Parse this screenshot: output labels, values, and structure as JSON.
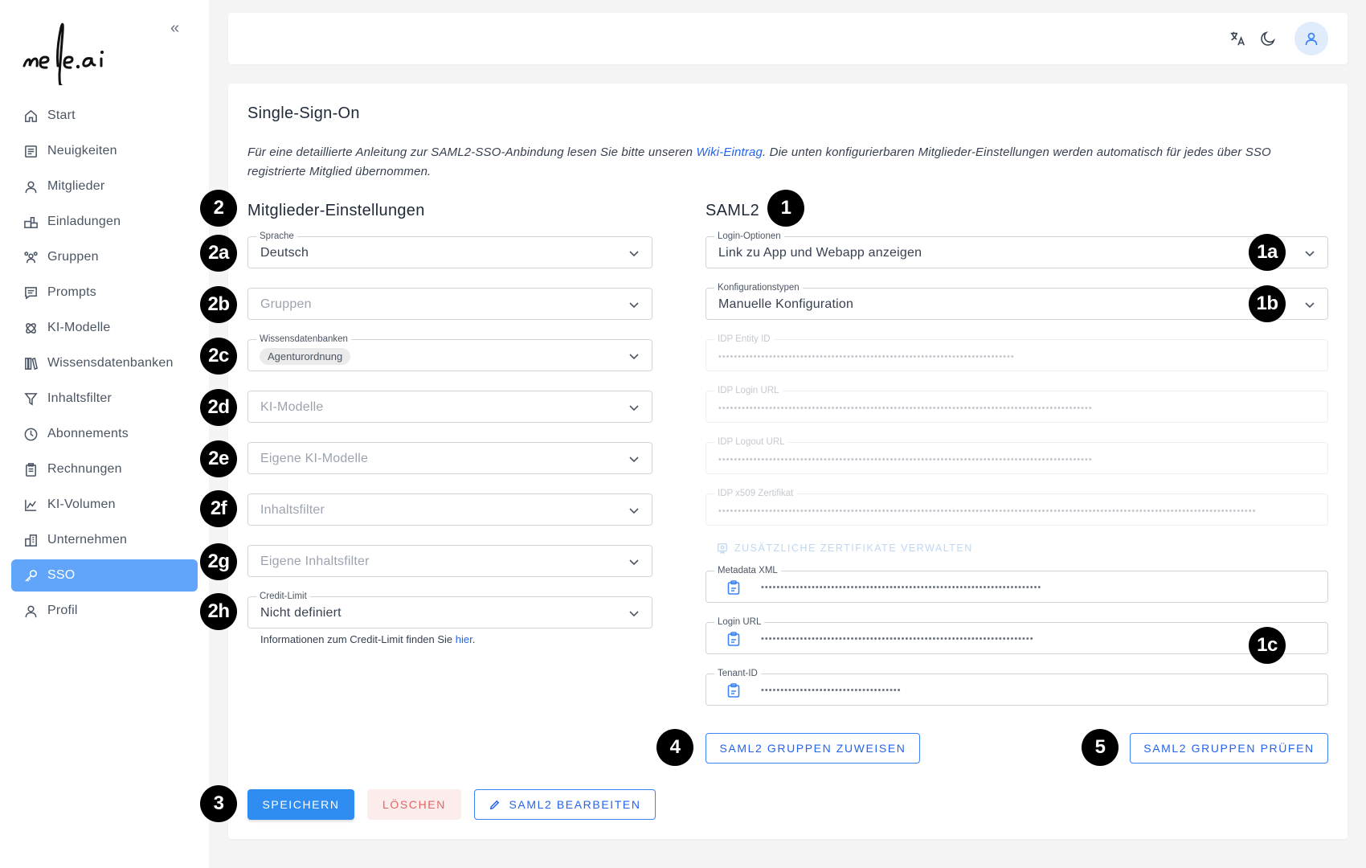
{
  "sidebar": {
    "brand": "nele.ai",
    "collapse_icon": "chevrons-left-icon",
    "items": [
      {
        "label": "Start",
        "icon": "home-icon"
      },
      {
        "label": "Neuigkeiten",
        "icon": "news-icon"
      },
      {
        "label": "Mitglieder",
        "icon": "user-icon"
      },
      {
        "label": "Einladungen",
        "icon": "invitation-icon"
      },
      {
        "label": "Gruppen",
        "icon": "group-icon"
      },
      {
        "label": "Prompts",
        "icon": "prompt-icon"
      },
      {
        "label": "KI-Modelle",
        "icon": "ai-model-icon"
      },
      {
        "label": "Wissensdatenbanken",
        "icon": "library-icon"
      },
      {
        "label": "Inhaltsfilter",
        "icon": "filter-icon"
      },
      {
        "label": "Abonnements",
        "icon": "clock-icon"
      },
      {
        "label": "Rechnungen",
        "icon": "clipboard-icon"
      },
      {
        "label": "KI-Volumen",
        "icon": "chart-icon"
      },
      {
        "label": "Unternehmen",
        "icon": "building-icon"
      },
      {
        "label": "SSO",
        "icon": "key-icon",
        "active": true
      },
      {
        "label": "Profil",
        "icon": "user-icon"
      }
    ],
    "active_color": "#60a5fa"
  },
  "topbar": {
    "icons": [
      "translate-icon",
      "dark-mode-moon-icon",
      "user-avatar-icon"
    ]
  },
  "page": {
    "title": "Single-Sign-On",
    "intro_part1": "Für eine detaillierte Anleitung zur SAML2-SSO-Anbindung lesen Sie bitte unseren ",
    "intro_link": "Wiki-Eintrag",
    "intro_part2": ". Die unten konfigurierbaren Mitglieder-Einstellungen werden automatisch für jedes über SSO registrierte Mitglied übernommen."
  },
  "members": {
    "title": "Mitglieder-Einstellungen",
    "sprache": {
      "label": "Sprache",
      "value": "Deutsch"
    },
    "gruppen": {
      "placeholder": "Gruppen"
    },
    "wissen": {
      "label": "Wissensdatenbanken",
      "chip": "Agenturordnung"
    },
    "ki": {
      "placeholder": "KI-Modelle"
    },
    "eigene_ki": {
      "placeholder": "Eigene KI-Modelle"
    },
    "filter": {
      "placeholder": "Inhaltsfilter"
    },
    "eigene_filter": {
      "placeholder": "Eigene Inhaltsfilter"
    },
    "credit": {
      "label": "Credit-Limit",
      "value": "Nicht definiert"
    },
    "help_text": "Informationen zum Credit-Limit finden Sie ",
    "help_link": "hier",
    "help_end": "."
  },
  "saml": {
    "title": "SAML2",
    "login_options": {
      "label": "Login-Optionen",
      "value": "Link zu App und Webapp anzeigen"
    },
    "config_type": {
      "label": "Konfigurationstypen",
      "value": "Manuelle Konfiguration"
    },
    "idp_entity": {
      "label": "IDP Entity ID",
      "masked": "••••••••••••••••••••••••••••••••••••••••••••••••••••••••••••••••••••••••••••"
    },
    "idp_login": {
      "label": "IDP Login URL",
      "masked": "••••••••••••••••••••••••••••••••••••••••••••••••••••••••••••••••••••••••••••••••••••••••••••••••"
    },
    "idp_logout": {
      "label": "IDP Logout URL",
      "masked": "••••••••••••••••••••••••••••••••••••••••••••••••••••••••••••••••••••••••••••••••••••••••••••••••"
    },
    "idp_cert": {
      "label": "IDP x509 Zertifikat",
      "masked": "••••••••••••••••••••••••••••••••••••••••••••••••••••••••••••••••••••••••••••••••••••••••••••••••••••••••••••••••••••••••••••••••••••••••••"
    },
    "extra_certs": "ZUSÄTZLICHE ZERTIFIKATE VERWALTEN",
    "metadata": {
      "label": "Metadata XML",
      "masked": "••••••••••••••••••••••••••••••••••••••••••••••••••••••••••••••••••••••••"
    },
    "login_url": {
      "label": "Login URL",
      "masked": "••••••••••••••••••••••••••••••••••••••••••••••••••••••••••••••••••••••"
    },
    "tenant": {
      "label": "Tenant-ID",
      "masked": "••••••••••••••••••••••••••••••••••••"
    }
  },
  "buttons": {
    "assign": "SAML2 GRUPPEN ZUWEISEN",
    "check": "SAML2 GRUPPEN PRÜFEN",
    "save": "SPEICHERN",
    "delete": "LÖSCHEN",
    "edit": "SAML2 BEARBEITEN"
  },
  "badges": {
    "b1": "1",
    "b1a": "1a",
    "b1b": "1b",
    "b1c": "1c",
    "b2": "2",
    "b2a": "2a",
    "b2b": "2b",
    "b2c": "2c",
    "b2d": "2d",
    "b2e": "2e",
    "b2f": "2f",
    "b2g": "2g",
    "b2h": "2h",
    "b3": "3",
    "b4": "4",
    "b5": "5"
  }
}
